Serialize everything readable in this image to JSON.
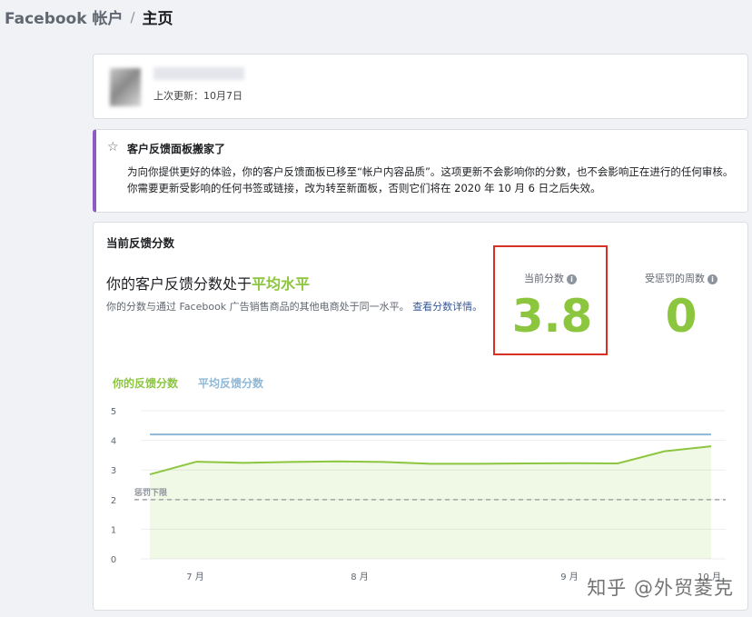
{
  "breadcrumb": {
    "account": "Facebook 帐户",
    "separator": "/",
    "current": "主页"
  },
  "profile": {
    "updated": "上次更新：10月7日"
  },
  "notice": {
    "title": "客户反馈面板搬家了",
    "body": "为向你提供更好的体验，你的客户反馈面板已移至“帐户内容品质”。这项更新不会影响你的分数，也不会影响正在进行的任何审核。你需要更新受影响的任何书签或链接，改为转至新面板，否则它们将在 2020 年 10 月 6 日之后失效。"
  },
  "feedback": {
    "section_title": "当前反馈分数",
    "headline_prefix": "你的客户反馈分数处于",
    "headline_level": "平均水平",
    "description": "你的分数与通过 Facebook 广告销售商品的其他电商处于同一水平。",
    "details_link": "查看分数详情。",
    "current_score_label": "当前分数",
    "current_score": "3.8",
    "penalty_weeks_label": "受惩罚的周数",
    "penalty_weeks": "0"
  },
  "colors": {
    "accent": "#8cc63f",
    "average_line": "#8fb8d6",
    "highlight_box": "#d93025",
    "notice_border": "#8b5cc4"
  },
  "watermark": "知乎 @外贸菱克",
  "chart_data": {
    "type": "line",
    "legend_position": "top-left",
    "x_ticks": [
      "7 月",
      "8 月",
      "9 月",
      "10 月"
    ],
    "ylim": [
      0,
      5
    ],
    "y_ticks": [
      "0",
      "1",
      "2",
      "3",
      "4",
      "5"
    ],
    "grid": true,
    "series": [
      {
        "name": "你的反馈分数",
        "color": "#8cc63f",
        "area": true,
        "values": [
          2.85,
          3.28,
          3.24,
          3.27,
          3.29,
          3.27,
          3.21,
          3.21,
          3.22,
          3.23,
          3.22,
          3.63,
          3.8
        ]
      },
      {
        "name": "平均反馈分数",
        "color": "#8fb8d6",
        "values": [
          4.2,
          4.2,
          4.2,
          4.2,
          4.2,
          4.2,
          4.2,
          4.2,
          4.2,
          4.2,
          4.2,
          4.2,
          4.2
        ]
      }
    ],
    "threshold": {
      "label": "惩罚下限",
      "value": 2
    }
  }
}
